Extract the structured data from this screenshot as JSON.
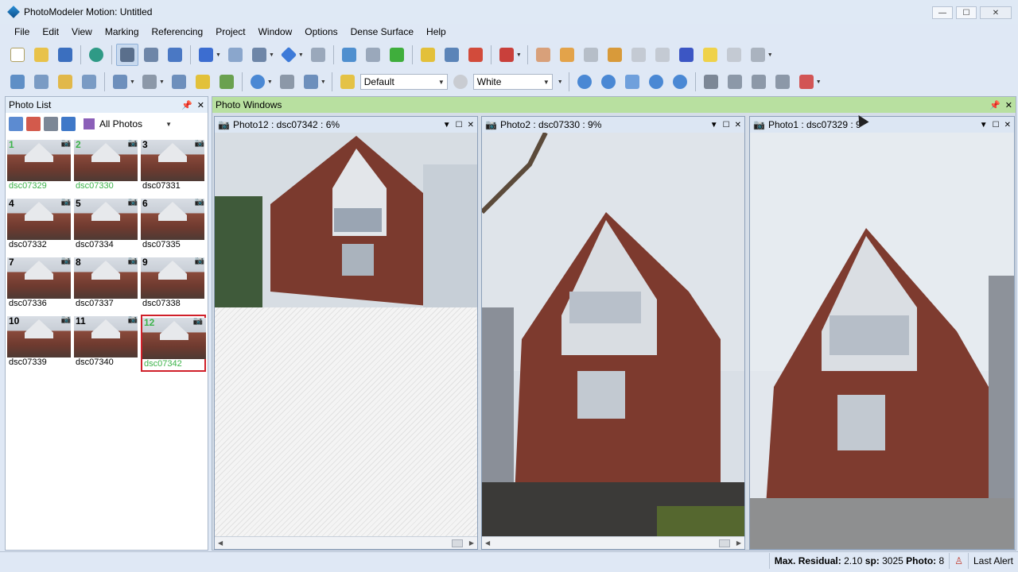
{
  "window": {
    "title": "PhotoModeler Motion: Untitled",
    "min": "—",
    "max": "☐",
    "close": "✕"
  },
  "menu": [
    {
      "label": "File"
    },
    {
      "label": "Edit"
    },
    {
      "label": "View"
    },
    {
      "label": "Marking"
    },
    {
      "label": "Referencing"
    },
    {
      "label": "Project"
    },
    {
      "label": "Window"
    },
    {
      "label": "Options"
    },
    {
      "label": "Dense Surface"
    },
    {
      "label": "Help"
    }
  ],
  "toolbar2": {
    "style_combo": "Default",
    "color_combo": "White"
  },
  "photo_list": {
    "title": "Photo List",
    "filter": "All Photos",
    "pin": "📌",
    "close": "✕",
    "photos": [
      {
        "num": "1",
        "label": "dsc07329",
        "num_green": true,
        "label_green": true
      },
      {
        "num": "2",
        "label": "dsc07330",
        "num_green": true,
        "label_green": true
      },
      {
        "num": "3",
        "label": "dsc07331",
        "num_green": false,
        "label_green": false
      },
      {
        "num": "4",
        "label": "dsc07332",
        "num_green": false,
        "label_green": false
      },
      {
        "num": "5",
        "label": "dsc07334",
        "num_green": false,
        "label_green": false
      },
      {
        "num": "6",
        "label": "dsc07335",
        "num_green": false,
        "label_green": false
      },
      {
        "num": "7",
        "label": "dsc07336",
        "num_green": false,
        "label_green": false
      },
      {
        "num": "8",
        "label": "dsc07337",
        "num_green": false,
        "label_green": false
      },
      {
        "num": "9",
        "label": "dsc07338",
        "num_green": false,
        "label_green": false
      },
      {
        "num": "10",
        "label": "dsc07339",
        "num_green": false,
        "label_green": false
      },
      {
        "num": "11",
        "label": "dsc07340",
        "num_green": false,
        "label_green": false
      },
      {
        "num": "12",
        "label": "dsc07342",
        "num_green": true,
        "label_green": true,
        "selected": true
      }
    ]
  },
  "photo_windows": {
    "title": "Photo Windows",
    "windows": [
      {
        "title": "Photo12 : dsc07342 : 6%"
      },
      {
        "title": "Photo2 : dsc07330 : 9%"
      },
      {
        "title": "Photo1 : dsc07329 : 9"
      }
    ]
  },
  "status": {
    "residual_label": "Max. Residual:",
    "residual_value": "2.10",
    "sp_label": "sp:",
    "sp_value": "3025",
    "photo_label": "Photo:",
    "photo_value": "8",
    "alert": "Last Alert"
  }
}
